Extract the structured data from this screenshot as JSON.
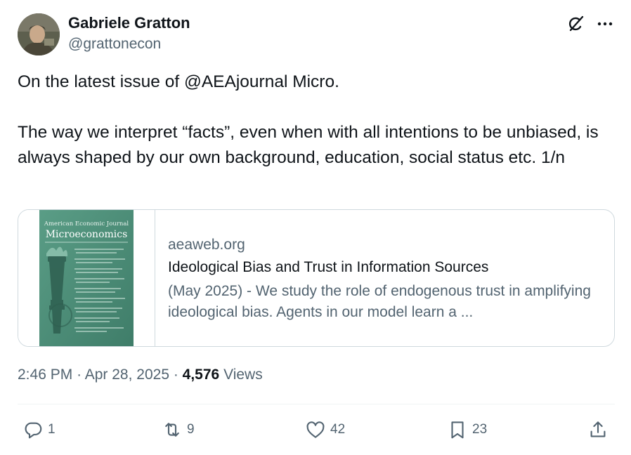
{
  "author": {
    "name": "Gabriele Gratton",
    "handle": "@grattonecon"
  },
  "header_icons": [
    "grok-icon",
    "more-icon"
  ],
  "tweet": {
    "paragraph1": "On the latest issue of @AEAjournal Micro.",
    "paragraph2": "The way we interpret “facts”, even when with all intentions to be unbiased, is always shaped by our own background, education, social status etc. 1/n"
  },
  "card": {
    "cover": {
      "journal": "American Economic Journal",
      "field": "Microeconomics"
    },
    "domain": "aeaweb.org",
    "title": "Ideological Bias and Trust in Information Sources",
    "description": "(May 2025) - We study the role of endogenous trust in amplifying ideological bias. Agents in our model learn a ..."
  },
  "meta": {
    "time": "2:46 PM",
    "date": "Apr 28, 2025",
    "views_count": "4,576",
    "views_label": "Views"
  },
  "actions": {
    "replies": "1",
    "reposts": "9",
    "likes": "42",
    "bookmarks": "23"
  },
  "colors": {
    "text": "#0f1419",
    "secondary": "#536471",
    "border": "#cfd9de",
    "cover_green": "#4f8f7a"
  }
}
